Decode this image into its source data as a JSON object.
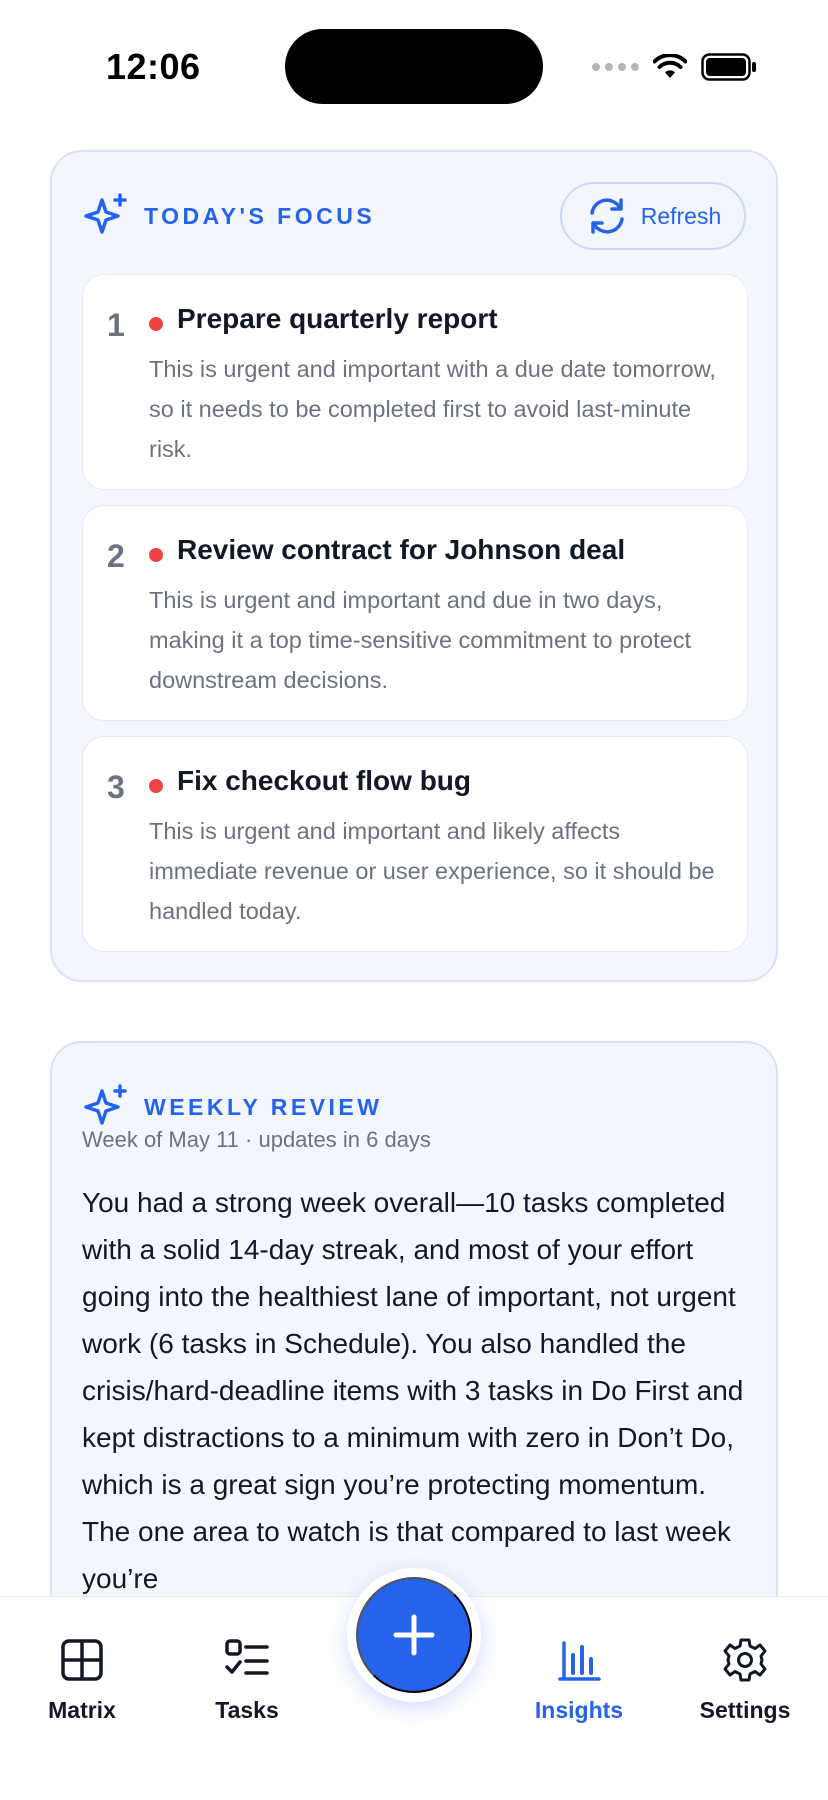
{
  "status_bar": {
    "time": "12:06"
  },
  "focus": {
    "label": "TODAY'S FOCUS",
    "refresh_label": "Refresh",
    "tasks": [
      {
        "number": "1",
        "title": "Prepare quarterly report",
        "description": "This is urgent and important with a due date tomorrow, so it needs to be completed first to avoid last-minute risk.",
        "priority_color": "#ef4444"
      },
      {
        "number": "2",
        "title": "Review contract for Johnson deal",
        "description": "This is urgent and important and due in two days, making it a top time-sensitive commitment to protect downstream decisions.",
        "priority_color": "#ef4444"
      },
      {
        "number": "3",
        "title": "Fix checkout flow bug",
        "description": "This is urgent and important and likely affects immediate revenue or user experience, so it should be handled today.",
        "priority_color": "#ef4444"
      }
    ]
  },
  "weekly": {
    "label": "WEEKLY REVIEW",
    "subtitle": "Week of May 11 · updates in 6 days",
    "body": "You had a strong week overall—10 tasks completed with a solid 14-day streak, and most of your effort going into the healthiest lane of important, not urgent work (6 tasks in Schedule). You also handled the crisis/hard-deadline items with 3 tasks in Do First and kept distractions to a minimum with zero in Don’t Do, which is a great sign you’re protecting momentum. The one area to watch is that compared to last week you’re"
  },
  "nav": {
    "items": [
      {
        "label": "Matrix",
        "icon": "grid-icon"
      },
      {
        "label": "Tasks",
        "icon": "checklist-icon"
      },
      {
        "label": "Insights",
        "icon": "bar-chart-icon"
      },
      {
        "label": "Settings",
        "icon": "gear-icon"
      }
    ],
    "active": "Insights",
    "fab_icon": "plus-icon"
  },
  "colors": {
    "accent": "#2563eb",
    "priority_high": "#ef4444",
    "card_bg": "#f3f7fd"
  }
}
